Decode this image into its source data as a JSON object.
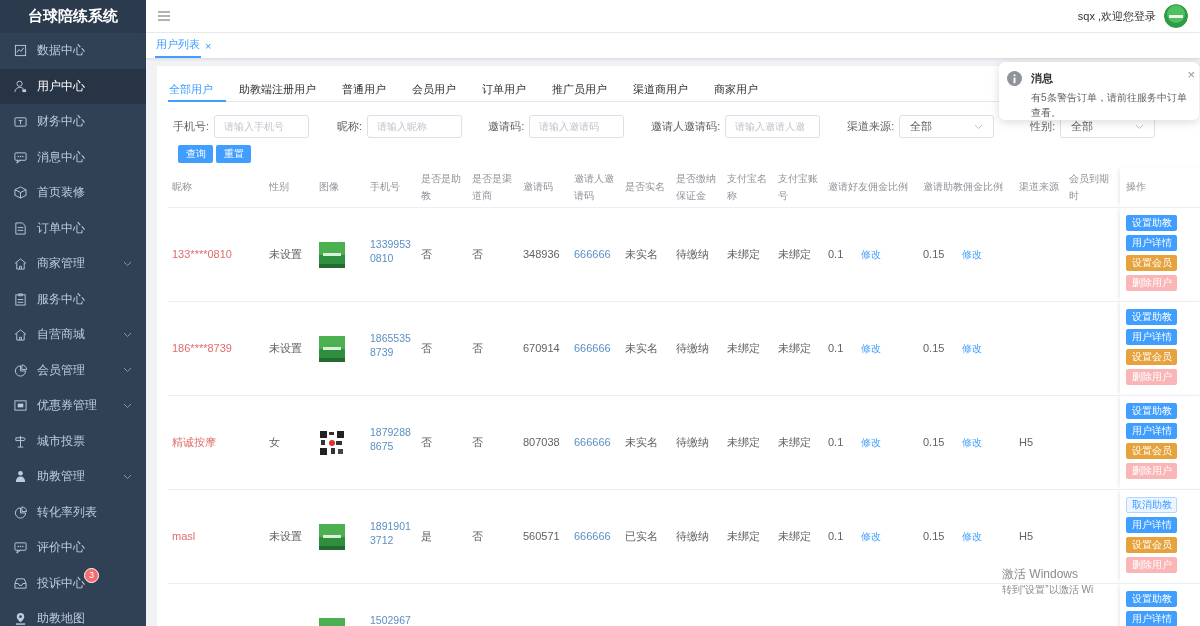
{
  "app_title": "台球陪练系统",
  "sidebar": {
    "items": [
      {
        "label": "数据中心",
        "kind": "chart",
        "selected": false,
        "expandable": false
      },
      {
        "label": "用户中心",
        "kind": "user",
        "selected": true,
        "expandable": false
      },
      {
        "label": "财务中心",
        "kind": "wallet",
        "selected": false,
        "expandable": false
      },
      {
        "label": "消息中心",
        "kind": "chat",
        "selected": false,
        "expandable": false
      },
      {
        "label": "首页装修",
        "kind": "box",
        "selected": false,
        "expandable": false
      },
      {
        "label": "订单中心",
        "kind": "doc",
        "selected": false,
        "expandable": false
      },
      {
        "label": "商家管理",
        "kind": "house",
        "selected": false,
        "expandable": true
      },
      {
        "label": "服务中心",
        "kind": "clipboard",
        "selected": false,
        "expandable": false
      },
      {
        "label": "自营商城",
        "kind": "house",
        "selected": false,
        "expandable": true
      },
      {
        "label": "会员管理",
        "kind": "pie",
        "selected": false,
        "expandable": true
      },
      {
        "label": "优惠券管理",
        "kind": "ticket",
        "selected": false,
        "expandable": true
      },
      {
        "label": "城市投票",
        "kind": "sign",
        "selected": false,
        "expandable": false
      },
      {
        "label": "助教管理",
        "kind": "person",
        "selected": false,
        "expandable": true
      },
      {
        "label": "转化率列表",
        "kind": "pie",
        "selected": false,
        "expandable": false
      },
      {
        "label": "评价中心",
        "kind": "chat",
        "selected": false,
        "expandable": false
      },
      {
        "label": "投诉中心",
        "kind": "inbox",
        "selected": false,
        "expandable": false,
        "badge": "3"
      },
      {
        "label": "助教地图",
        "kind": "pin",
        "selected": false,
        "expandable": false
      }
    ]
  },
  "header": {
    "greeting": "sqx ,欢迎您登录"
  },
  "page_tabs": [
    {
      "label": "用户列表",
      "selected": true,
      "close": "×"
    }
  ],
  "user_tabs": [
    {
      "label": "全部用户",
      "selected": true
    },
    {
      "label": "助教端注册用户",
      "selected": false
    },
    {
      "label": "普通用户",
      "selected": false
    },
    {
      "label": "会员用户",
      "selected": false
    },
    {
      "label": "订单用户",
      "selected": false
    },
    {
      "label": "推广员用户",
      "selected": false
    },
    {
      "label": "渠道商用户",
      "selected": false
    },
    {
      "label": "商家用户",
      "selected": false
    }
  ],
  "filters": [
    {
      "kind": "input",
      "label": "手机号:",
      "placeholder": "请输入手机号"
    },
    {
      "kind": "input",
      "label": "昵称:",
      "placeholder": "请输入昵称"
    },
    {
      "kind": "input",
      "label": "邀请码:",
      "placeholder": "请输入邀请码"
    },
    {
      "kind": "input",
      "label": "邀请人邀请码:",
      "placeholder": "请输入邀请人邀"
    },
    {
      "kind": "select",
      "label": "渠道来源:",
      "value": "全部"
    },
    {
      "kind": "select",
      "label": "性别:",
      "value": "全部"
    }
  ],
  "filter_buttons": [
    {
      "label": "查询",
      "kind": "primary"
    },
    {
      "label": "重置",
      "kind": "primary"
    }
  ],
  "table": {
    "columns": [
      "昵称",
      "性别",
      "图像",
      "手机号",
      "是否是助教",
      "是否是渠道商",
      "邀请码",
      "邀请人邀请码",
      "是否实名",
      "是否缴纳保证金",
      "支付宝名称",
      "支付宝账号",
      "邀请好友佣金比例",
      "邀请助教佣金比例",
      "渠道来源",
      "会员到期时",
      "操作"
    ],
    "rows": [
      {
        "nickname": "133****0810",
        "gender": "未设置",
        "image": {
          "kind": "picture"
        },
        "phone": "13399530810",
        "is_coach": "否",
        "is_channel": "否",
        "invite_code": "348936",
        "inviter_code": "666666",
        "real_name": "未实名",
        "deposit": "待缴纳",
        "alipay_name": "未绑定",
        "alipay_account": "未绑定",
        "friend_ratio": "0.1",
        "friend_edit": "修改",
        "coach_ratio": "0.15",
        "coach_edit": "修改",
        "actions": [
          {
            "label": "设置助教",
            "kind": "primary"
          },
          {
            "label": "用户详情",
            "kind": "primary"
          },
          {
            "label": "设置会员",
            "kind": "warning"
          },
          {
            "label": "删除用户",
            "kind": "danger"
          }
        ]
      },
      {
        "nickname": "186****8739",
        "gender": "未设置",
        "image": {
          "kind": "picture"
        },
        "phone": "18655358739",
        "is_coach": "否",
        "is_channel": "否",
        "invite_code": "670914",
        "inviter_code": "666666",
        "real_name": "未实名",
        "deposit": "待缴纳",
        "alipay_name": "未绑定",
        "alipay_account": "未绑定",
        "friend_ratio": "0.1",
        "friend_edit": "修改",
        "coach_ratio": "0.15",
        "coach_edit": "修改",
        "actions": [
          {
            "label": "设置助教",
            "kind": "primary"
          },
          {
            "label": "用户详情",
            "kind": "primary"
          },
          {
            "label": "设置会员",
            "kind": "warning"
          },
          {
            "label": "删除用户",
            "kind": "danger"
          }
        ]
      },
      {
        "nickname": "精诚按摩",
        "gender": "女",
        "image": {
          "kind": "picture"
        },
        "phone": "18792888675",
        "is_coach": "否",
        "is_channel": "否",
        "invite_code": "807038",
        "inviter_code": "666666",
        "real_name": "未实名",
        "deposit": "待缴纳",
        "alipay_name": "未绑定",
        "alipay_account": "未绑定",
        "friend_ratio": "0.1",
        "friend_edit": "修改",
        "coach_ratio": "0.15",
        "coach_edit": "修改",
        "channel": "H5",
        "actions": [
          {
            "label": "设置助教",
            "kind": "primary"
          },
          {
            "label": "用户详情",
            "kind": "primary"
          },
          {
            "label": "设置会员",
            "kind": "warning"
          },
          {
            "label": "删除用户",
            "kind": "danger"
          }
        ]
      },
      {
        "nickname": "masl",
        "gender": "未设置",
        "image": {
          "kind": "picture"
        },
        "phone": "18919013712",
        "is_coach": "是",
        "is_channel": "否",
        "invite_code": "560571",
        "inviter_code": "666666",
        "real_name": "已实名",
        "deposit": "待缴纳",
        "alipay_name": "未绑定",
        "alipay_account": "未绑定",
        "friend_ratio": "0.1",
        "friend_edit": "修改",
        "coach_ratio": "0.15",
        "coach_edit": "修改",
        "channel": "H5",
        "actions": [
          {
            "label": "取消助教",
            "kind": "plain"
          },
          {
            "label": "用户详情",
            "kind": "primary"
          },
          {
            "label": "设置会员",
            "kind": "warning"
          },
          {
            "label": "删除用户",
            "kind": "danger"
          }
        ]
      },
      {
        "image": {
          "kind": "picture"
        },
        "phone": "1502967",
        "actions": [
          {
            "label": "设置助教",
            "kind": "primary"
          },
          {
            "label": "用户详情",
            "kind": "primary"
          }
        ]
      }
    ]
  },
  "notification": {
    "title": "消息",
    "message": "有5条警告订单，请前往服务中订单查看。",
    "close": "×"
  },
  "os_notice": {
    "title": "激活 Windows",
    "subtitle": "转到“设置”以激活 Wi"
  }
}
